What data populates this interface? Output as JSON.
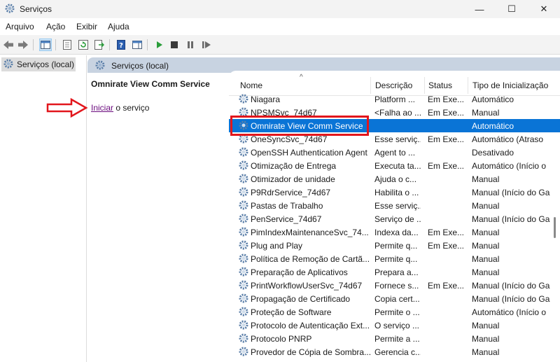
{
  "window": {
    "title": "Serviços",
    "min_glyph": "—",
    "max_glyph": "☐",
    "close_glyph": "✕",
    "app_icon": "gear-icon"
  },
  "menu": [
    "Arquivo",
    "Ação",
    "Exibir",
    "Ajuda"
  ],
  "toolbar": {
    "icons": [
      "back-arrow-icon",
      "forward-arrow-icon",
      "console-tree-icon",
      "properties-icon",
      "refresh-icon",
      "export-list-icon",
      "help-icon",
      "action-pane-icon",
      "start-service-icon",
      "stop-service-icon",
      "pause-service-icon",
      "restart-service-icon"
    ]
  },
  "tree": {
    "item": "Serviços (local)"
  },
  "panel": {
    "header": "Serviços (local)",
    "selected_service": "Omnirate View Comm Service",
    "start_link": "Iniciar",
    "start_suffix": " o serviço"
  },
  "table": {
    "headers": [
      "Nome",
      "Descrição",
      "Status",
      "Tipo de Inicialização"
    ],
    "rows": [
      {
        "name": "Niagara",
        "desc": "Platform ...",
        "status": "Em Exe...",
        "type": "Automático"
      },
      {
        "name": "NPSMSvc_74d67",
        "desc": "<Falha ao ...",
        "status": "Em Exe...",
        "type": "Manual"
      },
      {
        "name": "Omnirate View Comm Service",
        "desc": "",
        "status": "",
        "type": "Automático",
        "selected": true
      },
      {
        "name": "OneSyncSvc_74d67",
        "desc": "Esse serviç...",
        "status": "Em Exe...",
        "type": "Automático (Atraso"
      },
      {
        "name": "OpenSSH Authentication Agent",
        "desc": "Agent to ...",
        "status": "",
        "type": "Desativado"
      },
      {
        "name": "Otimização de Entrega",
        "desc": "Executa ta...",
        "status": "Em Exe...",
        "type": "Automático (Início o"
      },
      {
        "name": "Otimizador de unidade",
        "desc": "Ajuda o c...",
        "status": "",
        "type": "Manual"
      },
      {
        "name": "P9RdrService_74d67",
        "desc": "Habilita o ...",
        "status": "",
        "type": "Manual (Início do Ga"
      },
      {
        "name": "Pastas de Trabalho",
        "desc": "Esse serviç...",
        "status": "",
        "type": "Manual"
      },
      {
        "name": "PenService_74d67",
        "desc": "Serviço de ...",
        "status": "",
        "type": "Manual (Início do Ga"
      },
      {
        "name": "PimIndexMaintenanceSvc_74...",
        "desc": "Indexa da...",
        "status": "Em Exe...",
        "type": "Manual"
      },
      {
        "name": "Plug and Play",
        "desc": "Permite q...",
        "status": "Em Exe...",
        "type": "Manual"
      },
      {
        "name": "Política de Remoção de Cartã...",
        "desc": "Permite q...",
        "status": "",
        "type": "Manual"
      },
      {
        "name": "Preparação de Aplicativos",
        "desc": "Prepara a...",
        "status": "",
        "type": "Manual"
      },
      {
        "name": "PrintWorkflowUserSvc_74d67",
        "desc": "Fornece s...",
        "status": "Em Exe...",
        "type": "Manual (Início do Ga"
      },
      {
        "name": "Propagação de Certificado",
        "desc": "Copia cert...",
        "status": "",
        "type": "Manual (Início do Ga"
      },
      {
        "name": "Proteção de Software",
        "desc": "Permite o ...",
        "status": "",
        "type": "Automático (Início o"
      },
      {
        "name": "Protocolo de Autenticação Ext...",
        "desc": "O serviço ...",
        "status": "",
        "type": "Manual"
      },
      {
        "name": "Protocolo PNRP",
        "desc": "Permite a ...",
        "status": "",
        "type": "Manual"
      },
      {
        "name": "Provedor de Cópia de Sombra...",
        "desc": "Gerencia c...",
        "status": "",
        "type": "Manual"
      }
    ]
  },
  "colors": {
    "selection": "#0a74d6",
    "annotation": "#e2161c",
    "panel_header": "#c8d3e1",
    "link": "#6b0b7e"
  }
}
